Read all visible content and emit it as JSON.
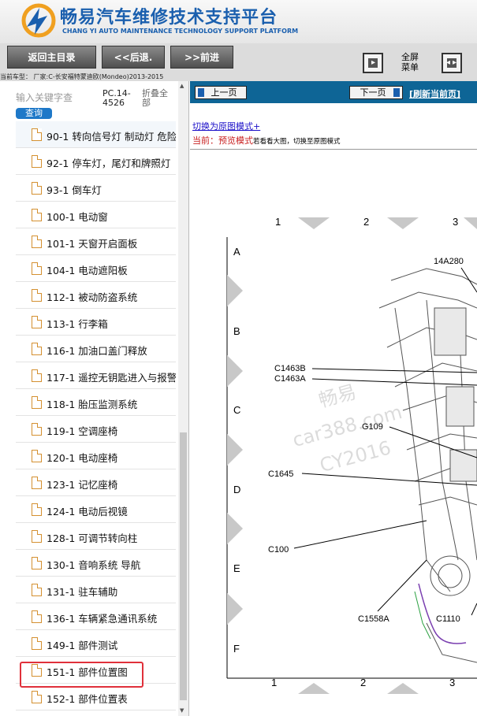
{
  "header": {
    "title_cn": "畅易汽车维修技术支持平台",
    "title_en": "CHANG YI AUTO MAINTENANCE TECHNOLOGY SUPPORT PLATFORM"
  },
  "toolbar": {
    "back_label": "返回主目录",
    "prev_label": "<<后退.",
    "next_label": ">>前进",
    "fullscreen_menu_label": "全屏菜单",
    "car_model": "当前车型：  厂家:C-长安福特蒙迪欧(Mondeo)2013-2015"
  },
  "sidebar": {
    "search_placeholder": "输入关键字查",
    "search_button": "查询",
    "pc_code": "PC.14-4526",
    "fold_all": "折叠全部",
    "items": [
      {
        "label": "90-1 转向信号灯 制动灯 危险"
      },
      {
        "label": "92-1 停车灯，尾灯和牌照灯"
      },
      {
        "label": "93-1 倒车灯"
      },
      {
        "label": "100-1 电动窗"
      },
      {
        "label": "101-1 天窗开启面板"
      },
      {
        "label": "104-1 电动遮阳板"
      },
      {
        "label": "112-1 被动防盗系统"
      },
      {
        "label": "113-1 行李箱"
      },
      {
        "label": "116-1 加油口盖门释放"
      },
      {
        "label": "117-1 遥控无钥匙进入与报警"
      },
      {
        "label": "118-1 胎压监测系统"
      },
      {
        "label": "119-1 空调座椅"
      },
      {
        "label": "120-1 电动座椅"
      },
      {
        "label": "123-1 记忆座椅"
      },
      {
        "label": "124-1 电动后视镜"
      },
      {
        "label": "128-1 可调节转向柱"
      },
      {
        "label": "130-1 音响系统 导航"
      },
      {
        "label": "131-1 驻车辅助"
      },
      {
        "label": "136-1 车辆紧急通讯系统"
      },
      {
        "label": "149-1 部件测试"
      },
      {
        "label": "151-1 部件位置图"
      },
      {
        "label": "152-1 部件位置表"
      }
    ]
  },
  "content": {
    "prev_page": "上一页",
    "next_page": "下一页",
    "refresh": "[刷新当前页]",
    "mode_switch": "切换为原图模式+",
    "current_label": "当前：预览模式",
    "current_tip": "若看看大图，切换至原图模式"
  },
  "diagram": {
    "col_numbers": [
      "1",
      "2",
      "3"
    ],
    "row_letters": [
      "A",
      "B",
      "C",
      "D",
      "E",
      "F"
    ],
    "callouts": [
      "14A280",
      "C1463B",
      "C1463A",
      "G109",
      "C1645",
      "C100",
      "C1558A",
      "C1110"
    ],
    "watermark": [
      "畅易",
      "car388.com",
      "CY2016"
    ]
  },
  "colors": {
    "brand_blue": "#1a5fae",
    "nav_bar": "#0e6596",
    "highlight_red": "#e0303a"
  }
}
